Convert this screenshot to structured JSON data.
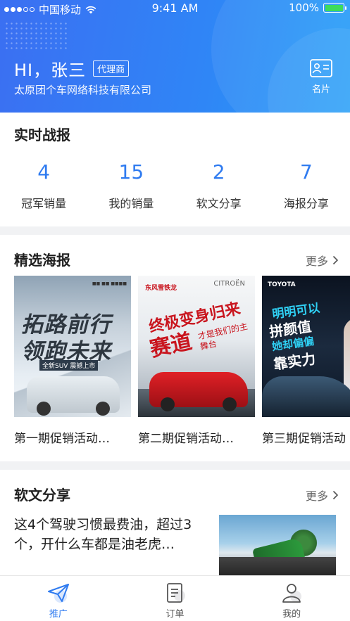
{
  "status_bar": {
    "carrier": "中国移动",
    "time": "9:41 AM",
    "battery": "100%"
  },
  "header": {
    "greeting": "HI，张三",
    "role_badge": "代理商",
    "company": "太原团个车网络科技有限公司",
    "card_label": "名片"
  },
  "stats_section": {
    "title": "实时战报",
    "items": [
      {
        "value": "4",
        "label": "冠军销量"
      },
      {
        "value": "15",
        "label": "我的销量"
      },
      {
        "value": "2",
        "label": "软文分享"
      },
      {
        "value": "7",
        "label": "海报分享"
      }
    ]
  },
  "posters_section": {
    "title": "精选海报",
    "more": "更多",
    "items": [
      {
        "caption": "第一期促销活动…",
        "art_line1": "拓路前行",
        "art_line2": "领跑未来",
        "art_tag": "全新SUV 震撼上市"
      },
      {
        "caption": "第二期促销活动…",
        "art_brand": "东风雪铁龙",
        "art_chevron": "CITROËN",
        "art_line1": "终极变身归来",
        "art_line2": "赛道",
        "art_line3": "才是我们的主舞台"
      },
      {
        "caption": "第三期促销活动",
        "art_brand": "TOYOTA",
        "art_line1": "明明可以",
        "art_line2": "拼颜值",
        "art_line3": "她却偏偏",
        "art_line4": "靠实力"
      }
    ]
  },
  "articles_section": {
    "title": "软文分享",
    "more": "更多",
    "first_article": "这4个驾驶习惯最费油，超过3个，开什么车都是油老虎…"
  },
  "tabbar": {
    "items": [
      {
        "label": "推广",
        "icon": "send-icon",
        "active": true
      },
      {
        "label": "订单",
        "icon": "order-icon",
        "active": false
      },
      {
        "label": "我的",
        "icon": "profile-icon",
        "active": false
      }
    ]
  },
  "colors": {
    "accent": "#2f7bf0",
    "header_start": "#3b6ff2",
    "header_end": "#2aa0f8",
    "poster_red": "#c9151e"
  }
}
